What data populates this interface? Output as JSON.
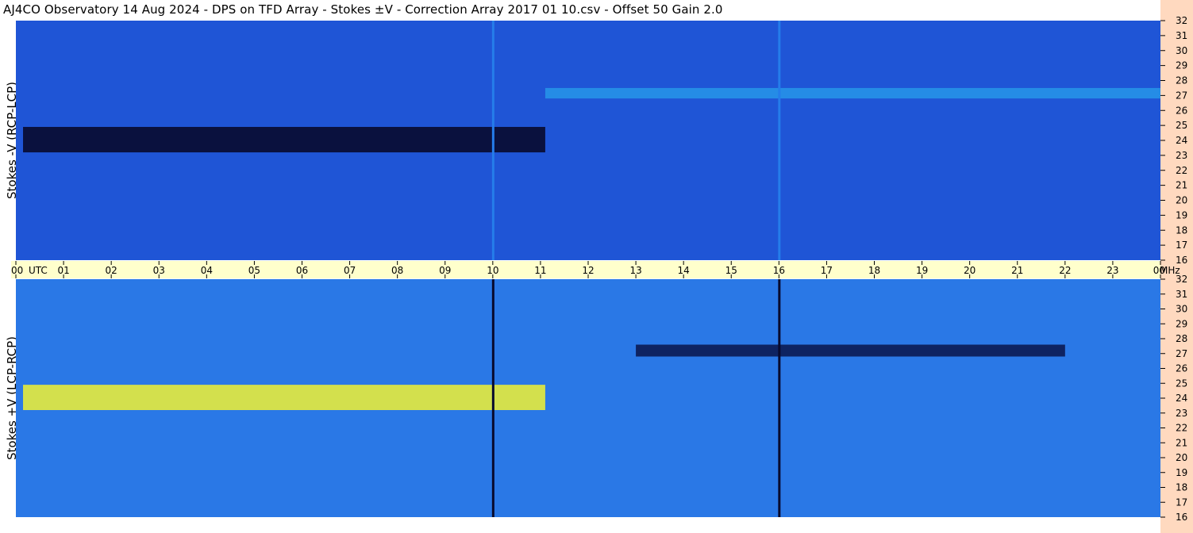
{
  "title": "AJ4CO Observatory  14 Aug 2024  -  DPS on TFD Array  -  Stokes ±V  -  Correction Array 2017 01 10.csv  -  Offset 50  Gain 2.0",
  "chart_data": {
    "type": "heatmap",
    "title": "AJ4CO Observatory  14 Aug 2024  -  DPS on TFD Array  -  Stokes ±V  -  Correction Array 2017 01 10.csv  -  Offset 50  Gain 2.0",
    "x_unit_label": "UTC",
    "y_unit_label": "MHz",
    "x_tick_labels": [
      "00",
      "01",
      "02",
      "03",
      "04",
      "05",
      "06",
      "07",
      "08",
      "09",
      "10",
      "11",
      "12",
      "13",
      "14",
      "15",
      "16",
      "17",
      "18",
      "19",
      "20",
      "21",
      "22",
      "23",
      "00"
    ],
    "y_tick_labels": [
      "32",
      "31",
      "30",
      "29",
      "28",
      "27",
      "26",
      "25",
      "24",
      "23",
      "22",
      "21",
      "20",
      "19",
      "18",
      "17",
      "16"
    ],
    "xlim": [
      0,
      24
    ],
    "ylim": [
      16,
      32
    ],
    "panels": [
      {
        "name": "Stokes -V (RCP-LCP)",
        "bands": [
          {
            "x0": 0.15,
            "x1": 11.1,
            "y0": 23.2,
            "y1": 24.9,
            "value": 0.0
          },
          {
            "x0": 11.1,
            "x1": 24.0,
            "y0": 26.8,
            "y1": 27.5,
            "value": 0.62
          }
        ],
        "vertical_lines": [
          {
            "x": 10.0,
            "value": 0.55
          },
          {
            "x": 16.0,
            "value": 0.55
          }
        ]
      },
      {
        "name": "Stokes +V (LCP-RCP)",
        "bands": [
          {
            "x0": 0.15,
            "x1": 11.1,
            "y0": 23.2,
            "y1": 24.9,
            "value": 1.0
          },
          {
            "x0": 13.0,
            "x1": 22.0,
            "y0": 26.8,
            "y1": 27.6,
            "value": 0.08
          }
        ],
        "vertical_lines": [
          {
            "x": 10.0,
            "value": 0.0
          },
          {
            "x": 16.0,
            "value": 0.0
          }
        ]
      }
    ]
  }
}
